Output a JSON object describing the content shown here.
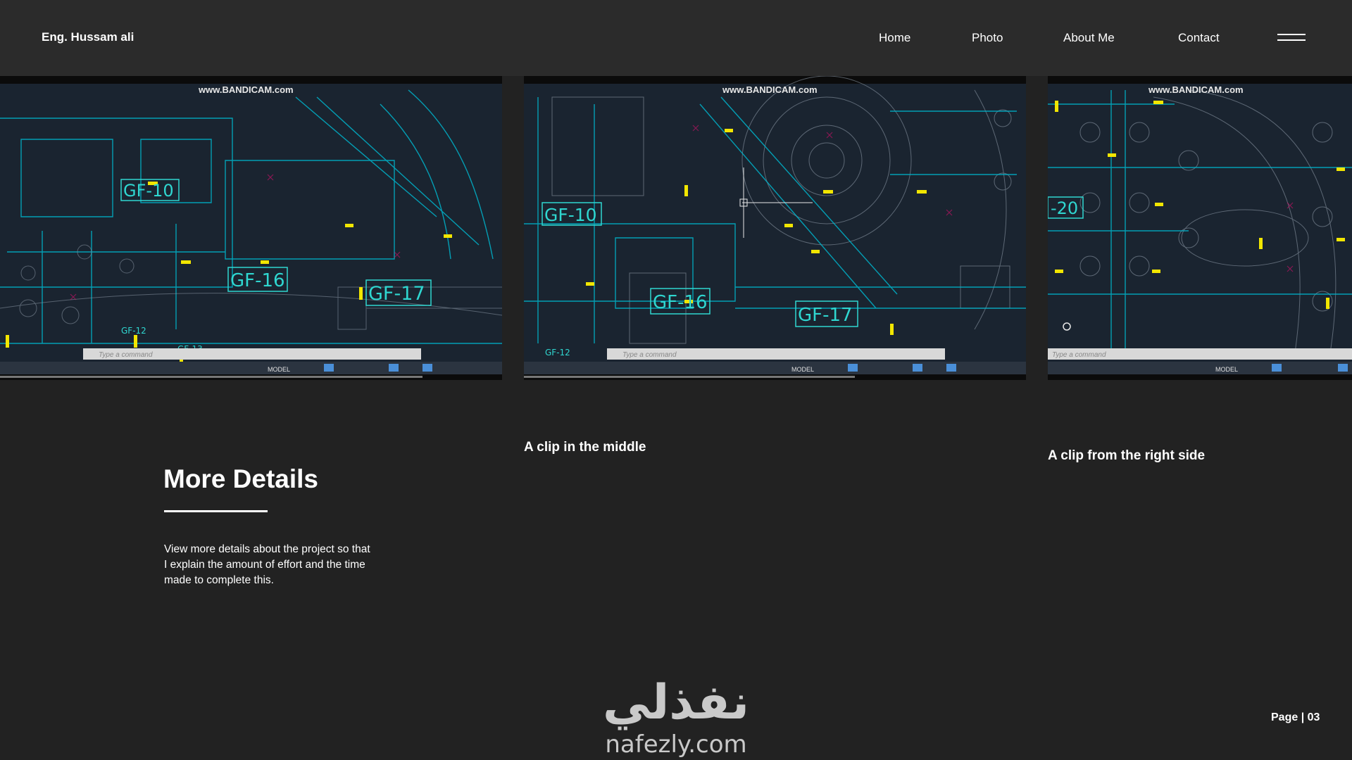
{
  "header": {
    "brand": "Eng. Hussam ali",
    "nav": [
      {
        "label": "Home"
      },
      {
        "label": "Photo"
      },
      {
        "label": "About Me"
      },
      {
        "label": "Contact"
      }
    ],
    "menu_icon": "hamburger-icon"
  },
  "clips": [
    {
      "watermark": "www.BANDICAM.com",
      "room_labels": [
        "GF-10",
        "GF-16",
        "GF-17",
        "GF-12",
        "GF-13"
      ],
      "command_placeholder": "Type a command",
      "status_mode": "MODEL"
    },
    {
      "watermark": "www.BANDICAM.com",
      "room_labels": [
        "GF-10",
        "GF-16",
        "GF-17",
        "GF-12"
      ],
      "command_placeholder": "Type a command",
      "status_mode": "MODEL"
    },
    {
      "watermark": "www.BANDICAM.com",
      "room_labels": [
        "-20"
      ],
      "command_placeholder": "Type a command",
      "status_mode": "MODEL"
    }
  ],
  "captions": {
    "middle": "A clip in the middle",
    "right": "A clip from the right side"
  },
  "details": {
    "heading": "More Details",
    "body": "View more details about the project so that I explain the amount of effort and the time made to complete this."
  },
  "watermark": {
    "arabic": "نفذلي",
    "latin": "nafezly.com"
  },
  "footer": {
    "page": "Page | 03"
  },
  "colors": {
    "background": "#222222",
    "navbar": "#2b2b2b",
    "cad_background": "#1a2430",
    "cad_lines": "#00c8e0",
    "cad_highlights": "#f2e600",
    "cad_accents": "#d0106a"
  }
}
